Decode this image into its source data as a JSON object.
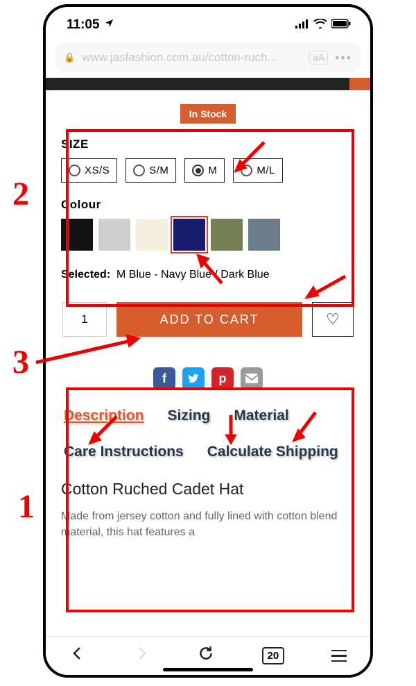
{
  "statusbar": {
    "time": "11:05"
  },
  "urlbar": {
    "url": "www.jasfashion.com.au/cotton-ruch..."
  },
  "stock_badge": "In Stock",
  "size": {
    "label": "SIZE",
    "options": [
      "XS/S",
      "S/M",
      "M",
      "M/L"
    ],
    "selected_index": 2
  },
  "colour": {
    "label": "Colour",
    "swatches": [
      "#111111",
      "#cfcfcf",
      "#f4efdc",
      "#171a6b",
      "#748054",
      "#6b7d89"
    ],
    "selected_index": 3
  },
  "selected_text": {
    "label": "Selected:",
    "value": "M  Blue - Navy Blue / Dark Blue"
  },
  "buy": {
    "qty": "1",
    "add_label": "ADD TO CART"
  },
  "tabs": [
    "Description",
    "Sizing",
    "Material",
    "Care Instructions",
    "Calculate Shipping"
  ],
  "product": {
    "title": "Cotton Ruched Cadet Hat",
    "desc": "Made from jersey cotton and fully lined with cotton blend material, this hat features a"
  },
  "toolbar": {
    "tab_count": "20"
  },
  "annotations": {
    "n1": "1",
    "n2": "2",
    "n3": "3"
  }
}
